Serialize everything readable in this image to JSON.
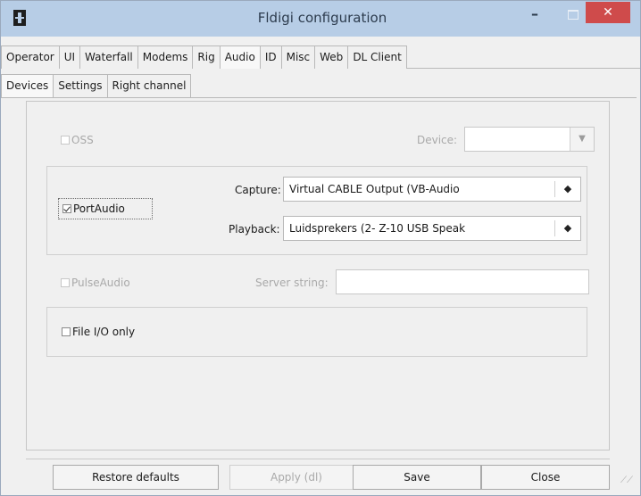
{
  "window": {
    "title": "Fldigi configuration",
    "minimize_glyph": "–",
    "close_glyph": "✕"
  },
  "tabs_main": [
    {
      "label": "Operator"
    },
    {
      "label": "UI"
    },
    {
      "label": "Waterfall"
    },
    {
      "label": "Modems"
    },
    {
      "label": "Rig"
    },
    {
      "label": "Audio",
      "active": true
    },
    {
      "label": "ID"
    },
    {
      "label": "Misc"
    },
    {
      "label": "Web"
    },
    {
      "label": "DL Client"
    }
  ],
  "tabs_audio": [
    {
      "label": "Devices",
      "active": true
    },
    {
      "label": "Settings"
    },
    {
      "label": "Right channel"
    }
  ],
  "oss": {
    "label": "OSS",
    "checked": false,
    "enabled": false,
    "device_label": "Device:",
    "device_value": ""
  },
  "portaudio": {
    "label": "PortAudio",
    "checked": true,
    "capture_label": "Capture:",
    "capture_value": "Virtual CABLE Output (VB-Audio",
    "playback_label": "Playback:",
    "playback_value": "Luidsprekers (2- Z-10 USB Speak"
  },
  "pulseaudio": {
    "label": "PulseAudio",
    "checked": false,
    "enabled": false,
    "server_label": "Server string:",
    "server_value": ""
  },
  "file_io": {
    "label": "File I/O only",
    "checked": false
  },
  "buttons": {
    "restore": "Restore defaults",
    "apply": "Apply (dl)",
    "save": "Save",
    "close": "Close"
  },
  "icons": {
    "dropdown": "chevron-down-icon",
    "spin": "up-down-arrows-icon",
    "resize": "resize-grip-icon"
  }
}
